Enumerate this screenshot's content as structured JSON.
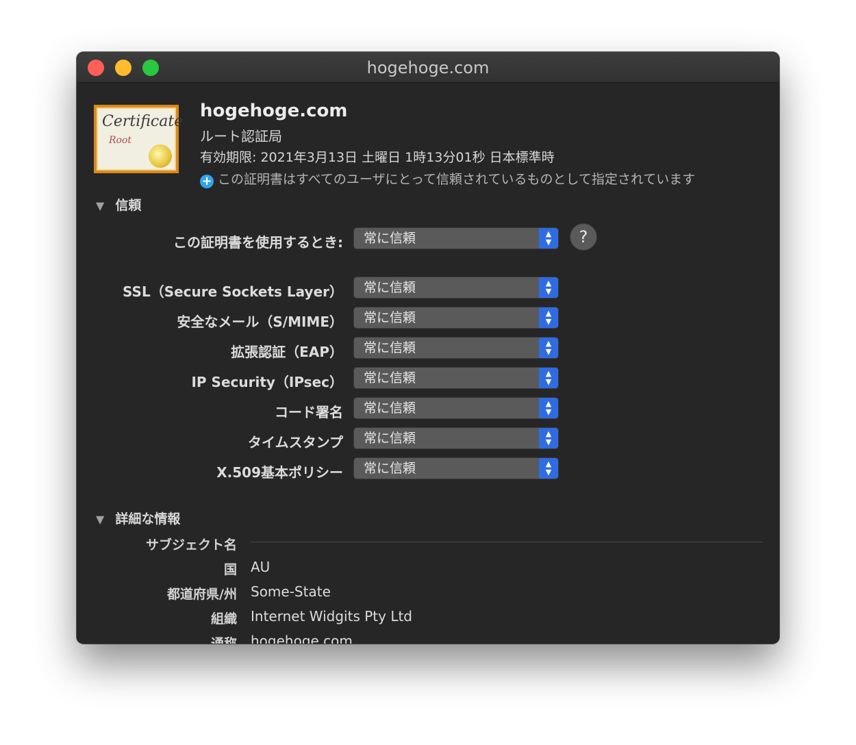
{
  "window": {
    "title": "hogehoge.com"
  },
  "certificate": {
    "name": "hogehoge.com",
    "type": "ルート認証局",
    "expiry": "有効期限: 2021年3月13日 土曜日 1時13分01秒 日本標準時",
    "trust_note": "この証明書はすべてのユーザにとって信頼されているものとして指定されています",
    "icon_text_1": "Certificate",
    "icon_text_2": "Root"
  },
  "trust": {
    "section_label": "信頼",
    "when_using_label": "この証明書を使用するとき:",
    "when_using_value": "常に信頼",
    "help": "?",
    "rows": [
      {
        "label": "SSL（Secure Sockets Layer）",
        "value": "常に信頼"
      },
      {
        "label": "安全なメール（S/MIME）",
        "value": "常に信頼"
      },
      {
        "label": "拡張認証（EAP）",
        "value": "常に信頼"
      },
      {
        "label": "IP Security（IPsec）",
        "value": "常に信頼"
      },
      {
        "label": "コード署名",
        "value": "常に信頼"
      },
      {
        "label": "タイムスタンプ",
        "value": "常に信頼"
      },
      {
        "label": "X.509基本ポリシー",
        "value": "常に信頼"
      }
    ]
  },
  "details": {
    "section_label": "詳細な情報",
    "subject_label": "サブジェクト名",
    "fields": [
      {
        "label": "国",
        "value": "AU"
      },
      {
        "label": "都道府県/州",
        "value": "Some-State"
      },
      {
        "label": "組織",
        "value": "Internet Widgits Pty Ltd"
      },
      {
        "label": "通称",
        "value": "hogehoge.com"
      }
    ]
  },
  "icons": {
    "close": "close-button",
    "minimize": "minimize-button",
    "maximize": "maximize-button",
    "disclosure": "disclosure-triangle-icon",
    "add": "plus-icon",
    "popup": "up-down-chevron-icon"
  },
  "colors": {
    "window_bg": "#262626",
    "accent": "#2f6ce1",
    "close": "#fe5f57",
    "minimize": "#febc2e",
    "maximize": "#28c840"
  }
}
